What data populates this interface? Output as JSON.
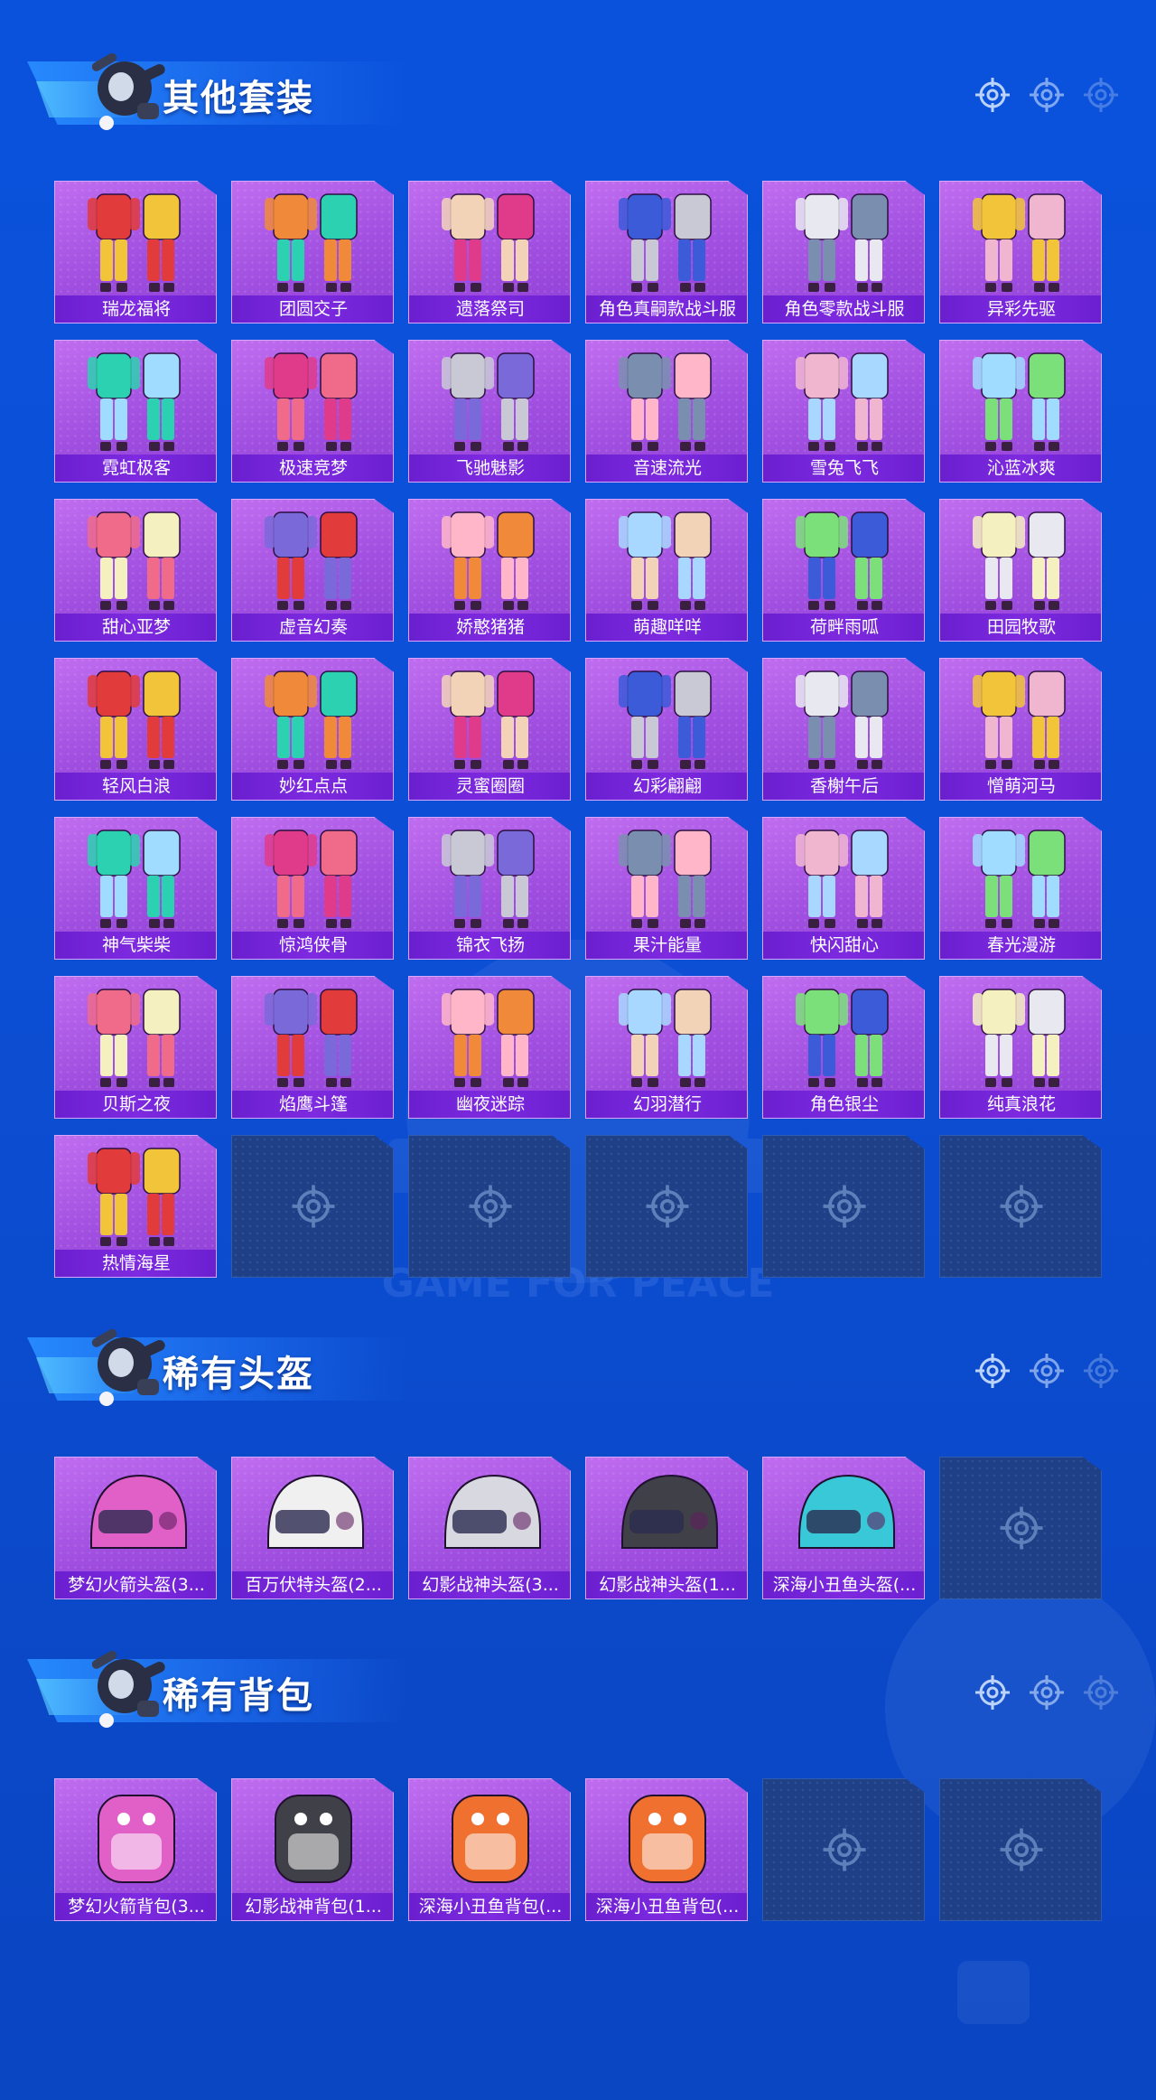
{
  "sections": [
    {
      "title": "其他套装",
      "items": [
        "瑞龙福将",
        "团圆交子",
        "遗落祭司",
        "角色真嗣款战斗服",
        "角色零款战斗服",
        "异彩先驱",
        "霓虹极客",
        "极速竞梦",
        "飞驰魅影",
        "音速流光",
        "雪兔飞飞",
        "沁蓝冰爽",
        "甜心亚梦",
        "虚音幻奏",
        "娇憨猪猪",
        "萌趣咩咩",
        "荷畔雨呱",
        "田园牧歌",
        "轻风白浪",
        "妙红点点",
        "灵蜜圈圈",
        "幻彩翩翩",
        "香榭午后",
        "憎萌河马",
        "神气柴柴",
        "惊鸿侠骨",
        "锦衣飞扬",
        "果汁能量",
        "快闪甜心",
        "春光漫游",
        "贝斯之夜",
        "焰鹰斗篷",
        "幽夜迷踪",
        "幻羽潜行",
        "角色银尘",
        "纯真浪花",
        "热情海星",
        "",
        "",
        "",
        "",
        ""
      ]
    },
    {
      "title": "稀有头盔",
      "items": [
        "梦幻火箭头盔(3...",
        "百万伏特头盔(2...",
        "幻影战神头盔(3...",
        "幻影战神头盔(1...",
        "深海小丑鱼头盔(...",
        ""
      ]
    },
    {
      "title": "稀有背包",
      "items": [
        "梦幻火箭背包(3...",
        "幻影战神背包(1...",
        "深海小丑鱼背包(...",
        "深海小丑鱼背包(...",
        "",
        ""
      ]
    }
  ],
  "watermark": "GAME FOR PEACE",
  "colors": {
    "background": "#0a52dc",
    "card_fill": "#a04fe0",
    "label_bar": "#6a1fcf",
    "empty_card": "#1f3f86"
  },
  "icons": {
    "header_reticle": "crosshair-reticle-icon",
    "empty_slot": "crosshair-reticle-icon",
    "mascot": "skydiver-mascot-icon"
  }
}
